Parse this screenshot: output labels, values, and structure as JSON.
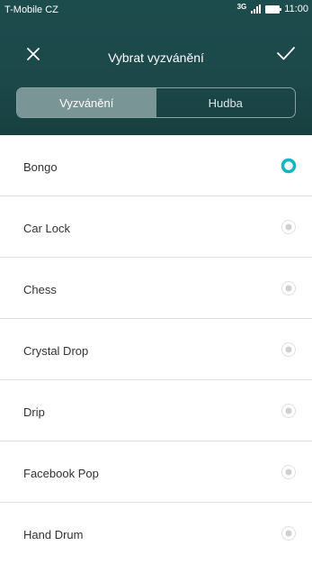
{
  "status": {
    "carrier": "T-Mobile CZ",
    "network": "3G",
    "time": "11:00"
  },
  "appbar": {
    "title": "Vybrat vyzvánění",
    "close_icon": "close-icon",
    "confirm_icon": "check-icon"
  },
  "tabs": [
    {
      "label": "Vyzvánění",
      "selected": true
    },
    {
      "label": "Hudba",
      "selected": false
    }
  ],
  "ringtones": [
    {
      "label": "Bongo",
      "selected": true
    },
    {
      "label": "Car Lock",
      "selected": false
    },
    {
      "label": "Chess",
      "selected": false
    },
    {
      "label": "Crystal Drop",
      "selected": false
    },
    {
      "label": "Drip",
      "selected": false
    },
    {
      "label": "Facebook Pop",
      "selected": false
    },
    {
      "label": "Hand Drum",
      "selected": false
    }
  ],
  "colors": {
    "header_bg": "#1c4849",
    "accent": "#13b6c0",
    "radio_unselected": "#d9d9d9"
  }
}
